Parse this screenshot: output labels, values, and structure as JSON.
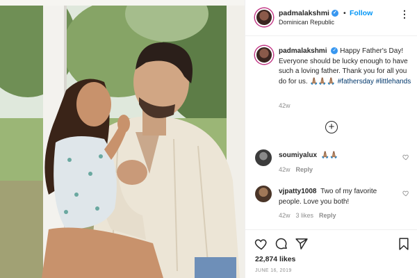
{
  "post": {
    "image_alt": "Father holding daughter on a porch"
  },
  "header": {
    "username": "padmalakshmi",
    "separator": "•",
    "follow_label": "Follow",
    "location": "Dominican Republic",
    "more_icon": "more-options-icon",
    "more_label": "⋮"
  },
  "caption": {
    "username": "padmalakshmi",
    "text": "Happy Father's Day! Everyone should be lucky enough to have such a loving father. Thank you for all you do for us. 🙏🏽🙏🏽🙏🏽",
    "hashtags": [
      "#fathersday",
      "#littlehands"
    ],
    "age": "42w"
  },
  "load_more_label": "+",
  "comments": [
    {
      "username": "soumiyalux",
      "text": "🙏🏽🙏🏽",
      "age": "42w",
      "likes": "",
      "reply_label": "Reply",
      "avatar_color": "#4a4a4a"
    },
    {
      "username": "vjpatty1008",
      "text": "Two of my favorite people. Love you both!",
      "age": "42w",
      "likes": "3 likes",
      "reply_label": "Reply",
      "avatar_color": "#6b5a48"
    }
  ],
  "actions": {
    "icons": [
      "heart-icon",
      "comment-icon",
      "share-icon",
      "bookmark-icon"
    ],
    "likes": "22,874 likes",
    "date": "JUNE 16, 2019"
  },
  "colors": {
    "link_blue": "#0095f6",
    "hashtag": "#00376b",
    "muted": "#8e8e8e",
    "text": "#262626",
    "verified": "#3897f0"
  }
}
